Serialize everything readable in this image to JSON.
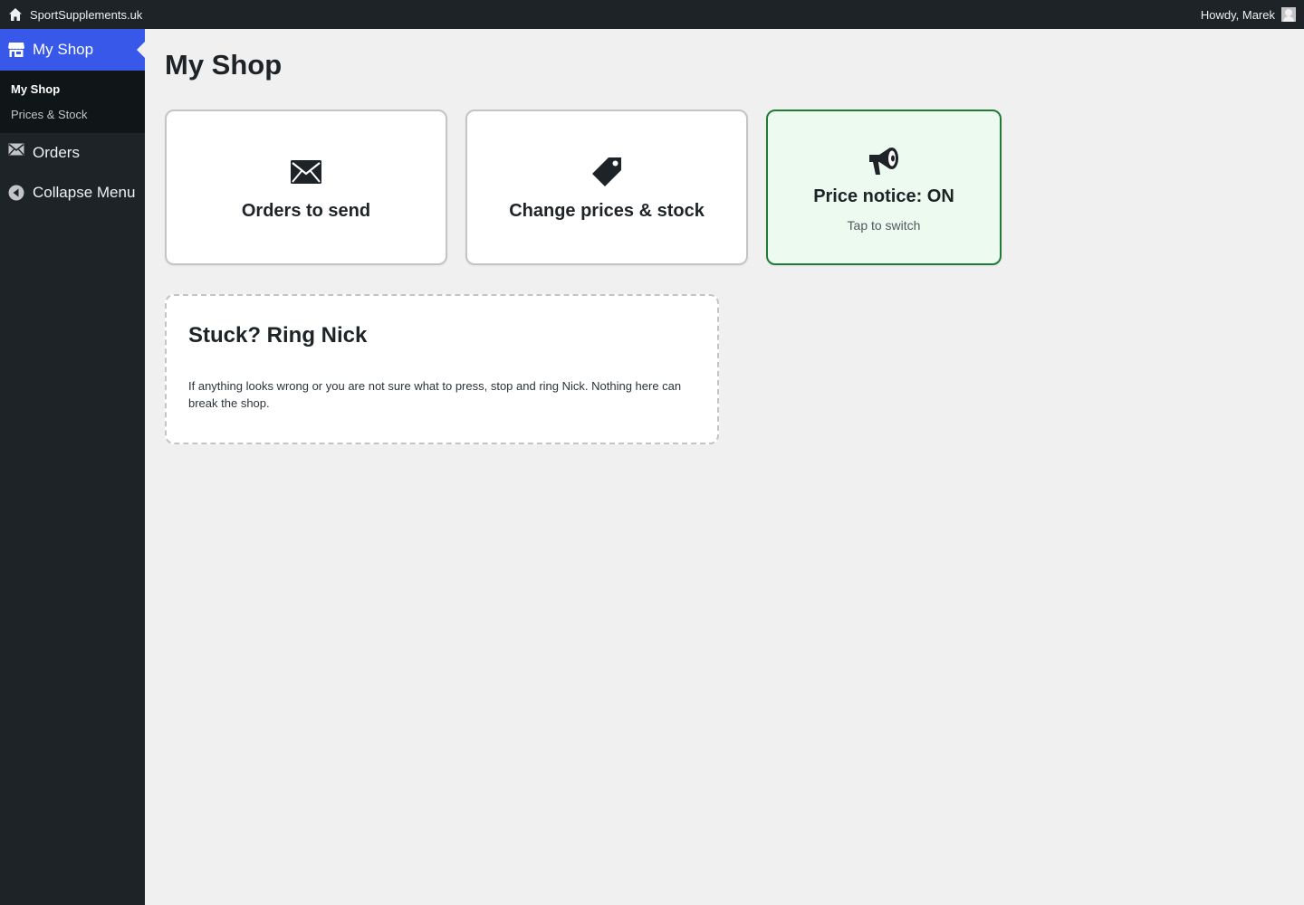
{
  "adminbar": {
    "site_name": "SportSupplements.uk",
    "greeting": "Howdy, Marek"
  },
  "sidebar": {
    "items": [
      {
        "label": "My Shop",
        "icon": "store-icon",
        "current": true
      },
      {
        "label": "Orders",
        "icon": "mail-icon"
      },
      {
        "label": "Collapse Menu",
        "icon": "collapse-icon"
      }
    ],
    "submenu": [
      {
        "label": "My Shop",
        "active": true
      },
      {
        "label": "Prices & Stock"
      }
    ]
  },
  "main": {
    "title": "My Shop",
    "tiles": [
      {
        "label": "Orders to send",
        "icon": "envelope-icon"
      },
      {
        "label": "Change prices & stock",
        "icon": "price-tag-icon"
      },
      {
        "label": "Price notice: ON",
        "sub": "Tap to switch",
        "icon": "megaphone-icon",
        "status": "on"
      }
    ],
    "help": {
      "title": "Stuck? Ring Nick",
      "text": "If anything looks wrong or you are not sure what to press, stop and ring Nick. Nothing here can break the shop."
    }
  },
  "colors": {
    "accent": "#3858e9",
    "sidebar_bg": "#1d2327",
    "notice_border": "#1e7b34",
    "notice_bg": "#edfaef"
  }
}
